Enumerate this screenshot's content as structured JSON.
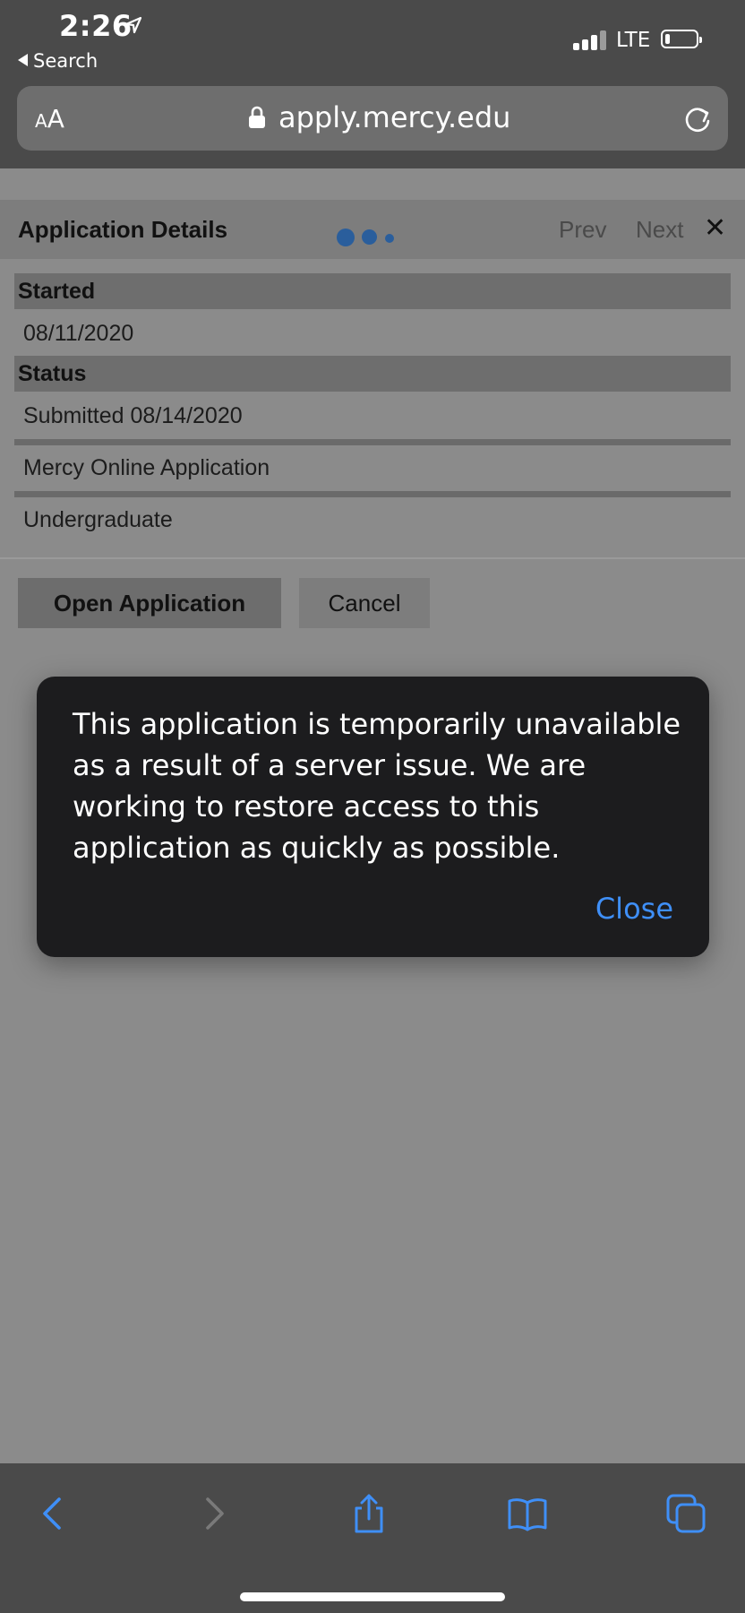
{
  "status_bar": {
    "time": "2:26",
    "back_label": "Search",
    "network": "LTE",
    "battery_level": 0.15
  },
  "url_bar": {
    "text_size_small": "A",
    "text_size_big": "A",
    "url": "apply.mercy.edu"
  },
  "dialog": {
    "title": "Application Details",
    "prev_label": "Prev",
    "next_label": "Next",
    "close_glyph": "✕",
    "sections": {
      "started_label": "Started",
      "started_value": "08/11/2020",
      "status_label": "Status",
      "status_value": "Submitted 08/14/2020",
      "application_name": "Mercy Online Application",
      "level": "Undergraduate"
    },
    "open_button": "Open Application",
    "cancel_button": "Cancel"
  },
  "alert": {
    "message": "This application is temporarily unavailable as a result of a server issue. We are working to restore access to this application as quickly as possible.",
    "close_label": "Close"
  },
  "toolbar": {
    "icons": [
      "back-arrow-icon",
      "forward-arrow-icon",
      "share-icon",
      "bookmarks-icon",
      "tabs-icon"
    ]
  },
  "colors": {
    "accent": "#3f8ff7",
    "spinner": "#2a5e9c"
  }
}
